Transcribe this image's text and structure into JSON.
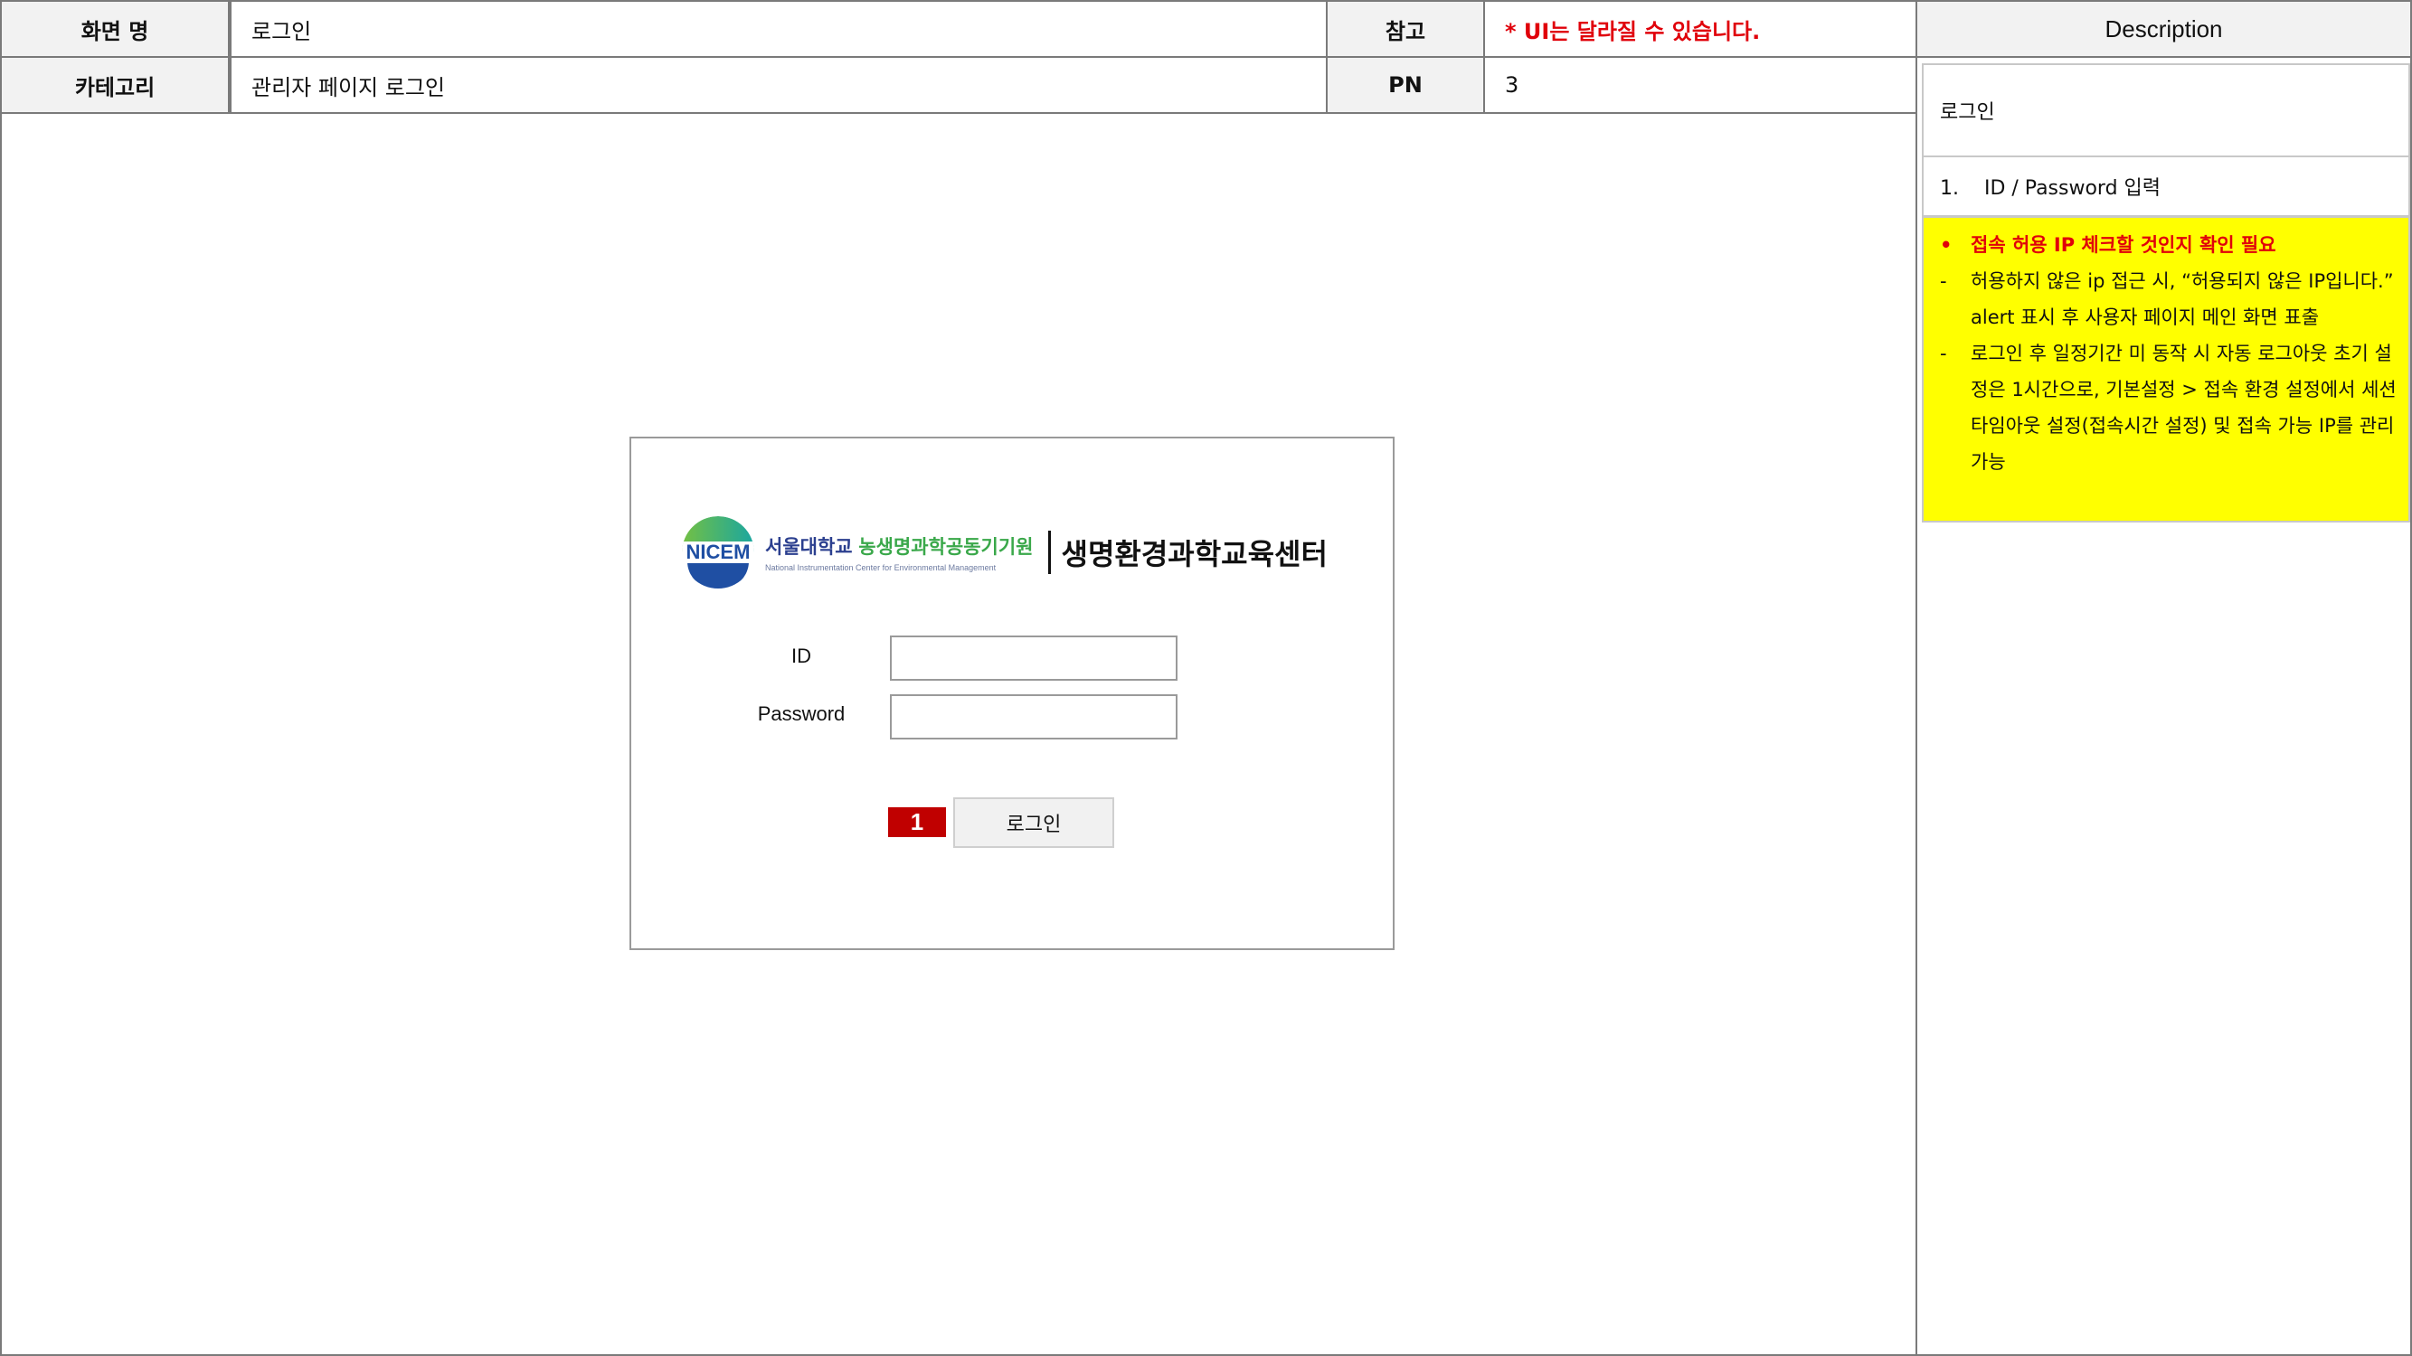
{
  "header": {
    "screen_name_label": "화면 명",
    "screen_name_value": "로그인",
    "reference_label": "참고",
    "reference_value": "* UI는 달라질 수 있습니다.",
    "category_label": "카테고리",
    "category_value": "관리자 페이지 로그인",
    "pn_label": "PN",
    "pn_value": "3"
  },
  "description": {
    "title": "Description",
    "summary": "로그인",
    "step1": "1.    ID / Password 입력",
    "bullets": [
      {
        "marker": "•",
        "text": "접속 허용 IP 체크할 것인지 확인 필요",
        "emphasis": true
      },
      {
        "marker": "-",
        "text": "허용하지 않은 ip 접근 시, “허용되지 않은 IP입니다.” alert 표시 후 사용자 페이지 메인 화면 표출",
        "emphasis": false
      },
      {
        "marker": "-",
        "text": "로그인 후 일정기간 미 동작 시 자동 로그아웃 초기 설정은 1시간으로, 기본설정 > 접속 환경 설정에서 세션 타임아웃 설정(접속시간 설정) 및  접속 가능 IP를 관리 가능",
        "emphasis": false
      }
    ]
  },
  "login": {
    "logo": {
      "mark_text": "NICEM",
      "university": "서울대학교",
      "institute": "농생명과학공동기기원",
      "english": "National Instrumentation Center for Environmental Management",
      "center_name": "생명환경과학교육센터"
    },
    "id_label": "ID",
    "id_value": "",
    "password_label": "Password",
    "password_value": "",
    "marker": "1",
    "login_button": "로그인"
  },
  "colors": {
    "border": "#7a7a7a",
    "label_bg": "#f2f2f2",
    "note_red": "#e0000a",
    "highlight_yellow": "#ffff00",
    "marker_red": "#c00000"
  }
}
